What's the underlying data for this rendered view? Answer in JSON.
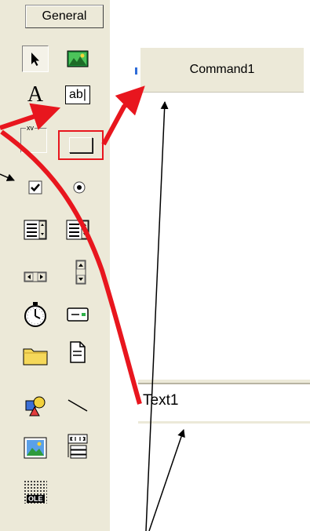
{
  "toolbox": {
    "title": "General",
    "tools": [
      {
        "name": "pointer",
        "icon": "pointer-icon"
      },
      {
        "name": "picture-box",
        "icon": "picture-box-icon"
      },
      {
        "name": "label",
        "icon": "label-icon",
        "text": "A"
      },
      {
        "name": "text-box",
        "icon": "textbox-icon",
        "text": "ab|"
      },
      {
        "name": "frame",
        "icon": "frame-icon",
        "text": "xv"
      },
      {
        "name": "command-button",
        "icon": "command-button-icon",
        "highlighted": true
      },
      {
        "name": "check-box",
        "icon": "checkbox-icon"
      },
      {
        "name": "option-button",
        "icon": "option-button-icon"
      },
      {
        "name": "combo-box",
        "icon": "combo-box-icon"
      },
      {
        "name": "list-box",
        "icon": "list-box-icon"
      },
      {
        "name": "hscroll-bar",
        "icon": "hscroll-icon"
      },
      {
        "name": "vscroll-bar",
        "icon": "vscroll-icon"
      },
      {
        "name": "timer",
        "icon": "timer-icon"
      },
      {
        "name": "drive-list-box",
        "icon": "drive-icon"
      },
      {
        "name": "dir-list-box",
        "icon": "folder-icon"
      },
      {
        "name": "file-list-box",
        "icon": "file-icon"
      },
      {
        "name": "shape",
        "icon": "shape-icon"
      },
      {
        "name": "line",
        "icon": "line-icon"
      },
      {
        "name": "image",
        "icon": "image-icon"
      },
      {
        "name": "data",
        "icon": "data-icon"
      },
      {
        "name": "ole",
        "icon": "ole-icon",
        "text": "OLE"
      }
    ]
  },
  "form": {
    "command_label": "Command1",
    "textbox_text": "Text1"
  },
  "colors": {
    "annotation_red": "#e8161e",
    "highlight_red": "#e8161e",
    "selection_blue": "#2f6cd8",
    "toolbox_bg": "#ece9d8"
  }
}
